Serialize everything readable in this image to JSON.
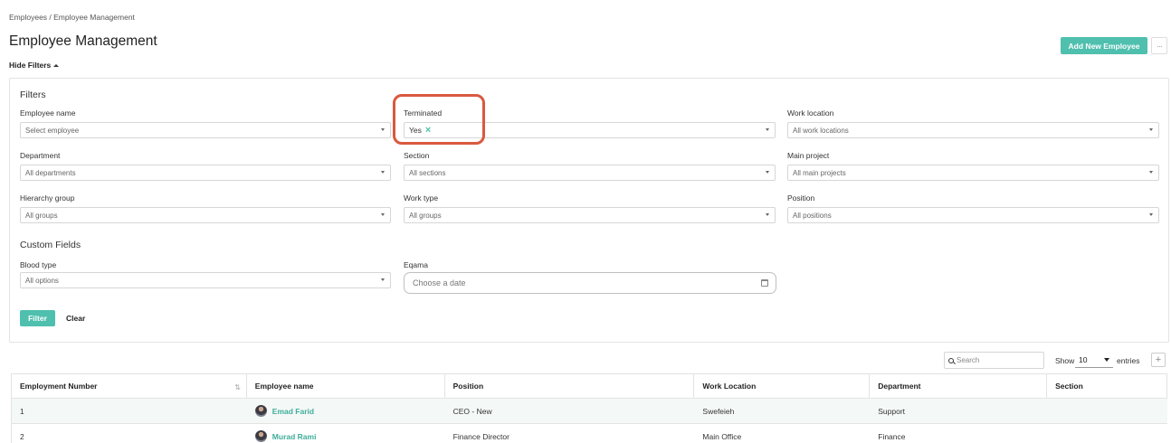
{
  "breadcrumb": "Employees / Employee Management",
  "page": {
    "title": "Employee Management",
    "add_button": "Add New Employee",
    "more_button": "···",
    "hide_filters": "Hide Filters"
  },
  "filters": {
    "title": "Filters",
    "employee_name": {
      "label": "Employee name",
      "value": "Select employee"
    },
    "terminated": {
      "label": "Terminated",
      "value": "Yes",
      "remove": "×"
    },
    "work_location": {
      "label": "Work location",
      "value": "All work locations"
    },
    "department": {
      "label": "Department",
      "value": "All departments"
    },
    "section": {
      "label": "Section",
      "value": "All sections"
    },
    "main_project": {
      "label": "Main project",
      "value": "All main projects"
    },
    "hierarchy_group": {
      "label": "Hierarchy group",
      "value": "All groups"
    },
    "work_type": {
      "label": "Work type",
      "value": "All groups"
    },
    "position": {
      "label": "Position",
      "value": "All positions"
    },
    "custom_title": "Custom Fields",
    "blood_type": {
      "label": "Blood type",
      "value": "All options"
    },
    "eqama": {
      "label": "Eqama",
      "placeholder": "Choose a date"
    },
    "filter_button": "Filter",
    "clear_button": "Clear"
  },
  "table_controls": {
    "search_placeholder": "Search",
    "show_label": "Show",
    "entries_value": "10",
    "entries_label": "entries",
    "plus": "+"
  },
  "table": {
    "columns": [
      "Employment Number",
      "Employee name",
      "Position",
      "Work Location",
      "Department",
      "Section"
    ],
    "sort_icon": "⇅",
    "rows": [
      {
        "number": "1",
        "name": "Emad Farid",
        "position": "CEO - New",
        "location": "Swefeieh",
        "department": "Support",
        "section": ""
      },
      {
        "number": "2",
        "name": "Murad Rami",
        "position": "Finance Director",
        "location": "Main Office",
        "department": "Finance",
        "section": ""
      }
    ]
  },
  "colors": {
    "accent": "#4fbfae",
    "highlight": "#d9593e"
  }
}
